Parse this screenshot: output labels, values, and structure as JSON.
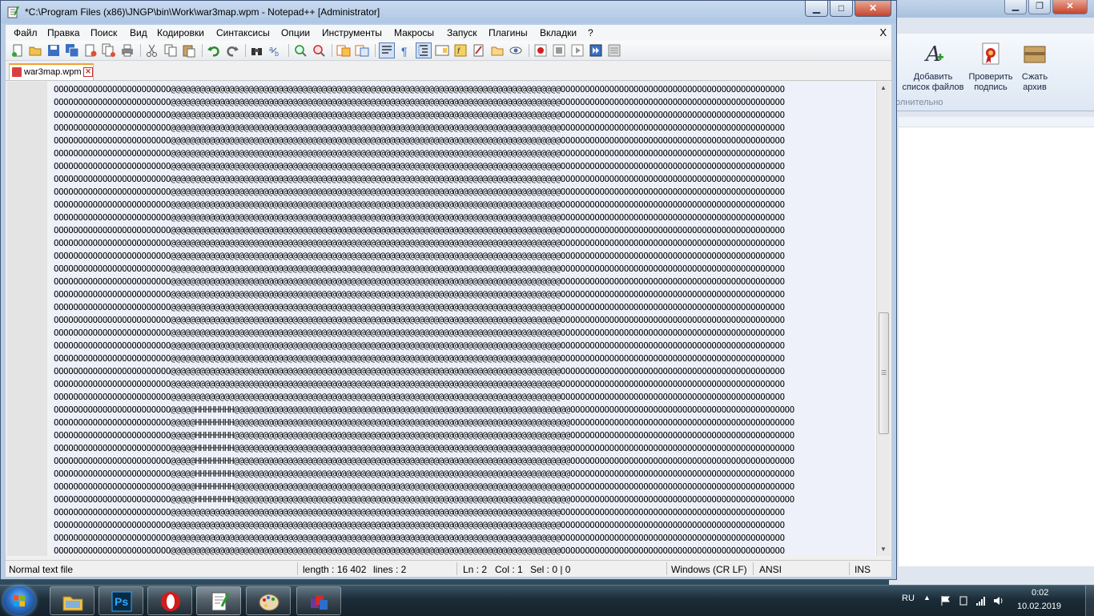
{
  "background_app": {
    "ribbon_buttons": [
      {
        "label_line1": "Добавить",
        "label_line2": "список файлов",
        "icon": "add-file-list-icon"
      },
      {
        "label_line1": "Проверить",
        "label_line2": "подпись",
        "icon": "verify-signature-icon"
      },
      {
        "label_line1": "Сжать",
        "label_line2": "архив",
        "icon": "compress-archive-icon"
      }
    ],
    "group_label": "олнительно"
  },
  "window": {
    "title": "*C:\\Program Files (x86)\\JNGP\\bin\\Work\\war3map.wpm - Notepad++ [Administrator]",
    "controls": {
      "minimize": "▁",
      "maximize": "□",
      "close": "✕"
    }
  },
  "menu": {
    "items": [
      "Файл",
      "Правка",
      "Поиск",
      "Вид",
      "Кодировки",
      "Синтаксисы",
      "Опции",
      "Инструменты",
      "Макросы",
      "Запуск",
      "Плагины",
      "Вкладки",
      "?"
    ],
    "close": "X"
  },
  "toolbar": {
    "buttons": [
      "new-file-icon",
      "open-file-icon",
      "save-icon",
      "save-all-icon",
      "close-icon",
      "close-all-icon",
      "print-icon",
      "cut-icon",
      "copy-icon",
      "paste-icon",
      "undo-icon",
      "redo-icon",
      "find-icon",
      "replace-icon",
      "zoom-in-icon",
      "zoom-out-icon",
      "sync-vertical-icon",
      "sync-horizontal-icon",
      "word-wrap-icon",
      "show-all-chars-icon",
      "indent-guide-icon",
      "doc-map-icon",
      "function-list-icon",
      "folder-as-workspace-icon",
      "monitoring-icon",
      "record-macro-icon",
      "stop-record-icon",
      "play-macro-icon",
      "run-macro-multiple-icon",
      "save-macro-icon"
    ]
  },
  "tabs": [
    {
      "label": "war3map.wpm",
      "modified": true
    }
  ],
  "editor": {
    "line_patterns": {
      "plain": "OOOOOOOOOOOOOOOOOOOOOOOO@@@@@@@@@@@@@@@@@@@@@@@@@@@@@@@@@@@@@@@@@@@@@@@@@@@@@@@@@@@@@@@@@@@@@@@@@@@@@@@@OOOOOOOOOOOOOOOOOOOOOOOOOOOOOOOOOOOOOOOOOOOOOO",
      "with_h": "OOOOOOOOOOOOOOOOOOOOOOOO@@@@@HHHHHHHH@@@@@@@@@@@@@@@@@@@@@@@@@@@@@@@@@@@@@@@@@@@@@@@@@@@@@@@@@@@@@@@@@@@@@OOOOOOOOOOOOOOOOOOOOOOOOOOOOOOOOOOOOOOOOOOOOOO"
    },
    "line_sequence": [
      "plain",
      "plain",
      "plain",
      "plain",
      "plain",
      "plain",
      "plain",
      "plain",
      "plain",
      "plain",
      "plain",
      "plain",
      "plain",
      "plain",
      "plain",
      "plain",
      "plain",
      "plain",
      "plain",
      "plain",
      "plain",
      "plain",
      "plain",
      "plain",
      "plain",
      "with_h",
      "with_h",
      "with_h",
      "with_h",
      "with_h",
      "with_h",
      "with_h",
      "with_h",
      "plain",
      "plain",
      "plain",
      "plain"
    ]
  },
  "status": {
    "file_type": "Normal text file",
    "length": "length : 16 402",
    "lines": "lines : 2",
    "ln": "Ln : 2",
    "col": "Col : 1",
    "sel": "Sel : 0 | 0",
    "eol": "Windows (CR LF)",
    "encoding": "ANSI",
    "mode": "INS"
  },
  "taskbar": {
    "apps": [
      "explorer-icon",
      "photoshop-icon",
      "opera-icon",
      "notepad-plus-plus-icon",
      "paint-icon",
      "winrar-icon"
    ],
    "photoshop_label": "Ps",
    "language": "RU",
    "time": "0:02",
    "date": "10.02.2019"
  }
}
